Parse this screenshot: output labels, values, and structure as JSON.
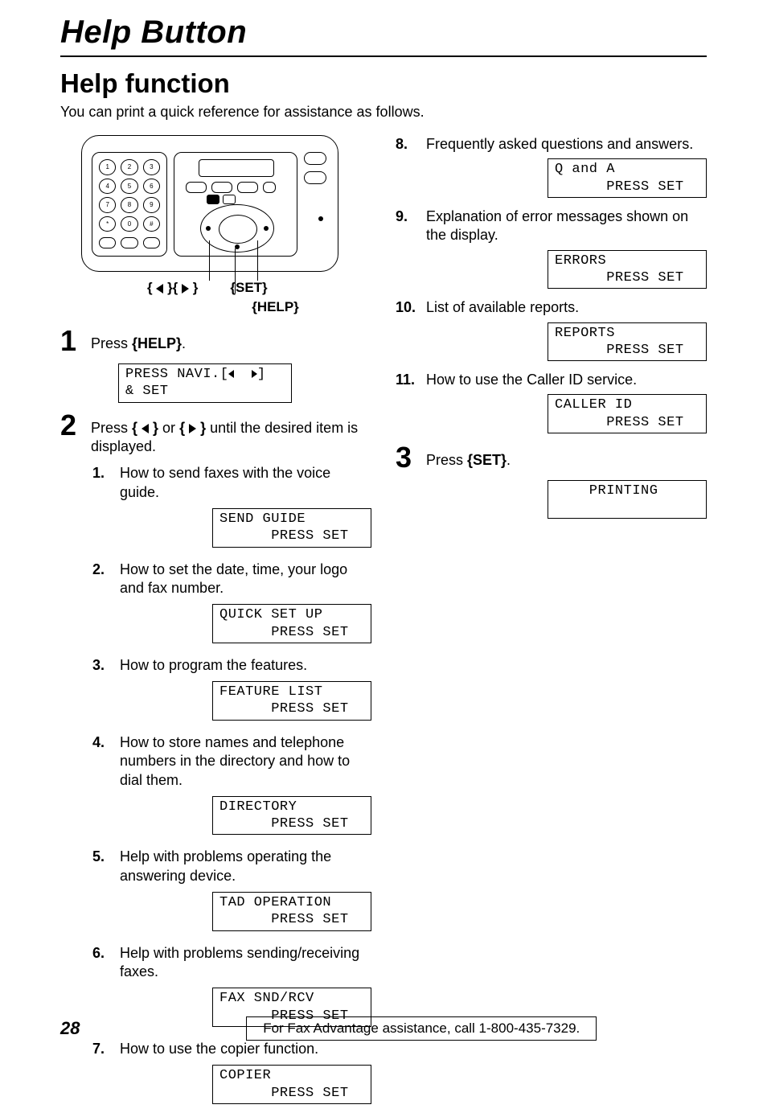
{
  "title": "Help Button",
  "h2": "Help function",
  "intro": "You can print a quick reference for assistance as follows.",
  "labels": {
    "arrows": "{ ◀ }{ ▶ }",
    "set": "{SET}",
    "help": "{HELP}"
  },
  "step1": {
    "num": "1",
    "pre": "Press ",
    "kw": "{HELP}",
    "post": "."
  },
  "lcd_step1_l1": "PRESS NAVI.[",
  "lcd_step1_l1b": "]",
  "lcd_step1_l2": "& SET",
  "step2": {
    "num": "2",
    "t1": "Press ",
    "t2": " or ",
    "t3": " until the desired item is displayed."
  },
  "step3": {
    "num": "3",
    "pre": "Press ",
    "kw": "{SET}",
    "post": "."
  },
  "items": [
    {
      "n": "1.",
      "t": "How to send faxes with the voice guide.",
      "l1": "SEND GUIDE",
      "l2": "      PRESS SET"
    },
    {
      "n": "2.",
      "t": "How to set the date, time, your logo and fax number.",
      "l1": "QUICK SET UP",
      "l2": "      PRESS SET"
    },
    {
      "n": "3.",
      "t": "How to program the features.",
      "l1": "FEATURE LIST",
      "l2": "      PRESS SET"
    },
    {
      "n": "4.",
      "t": "How to store names and telephone numbers in the directory and how to dial them.",
      "l1": "DIRECTORY",
      "l2": "      PRESS SET"
    },
    {
      "n": "5.",
      "t": "Help with problems operating the answering device.",
      "l1": "TAD OPERATION",
      "l2": "      PRESS SET"
    },
    {
      "n": "6.",
      "t": "Help with problems sending/receiving faxes.",
      "l1": "FAX SND/RCV",
      "l2": "      PRESS SET"
    },
    {
      "n": "7.",
      "t": "How to use the copier function.",
      "l1": "COPIER",
      "l2": "      PRESS SET"
    },
    {
      "n": "8.",
      "t": "Frequently asked questions and answers.",
      "l1": "Q and A",
      "l2": "      PRESS SET"
    },
    {
      "n": "9.",
      "t": "Explanation of error messages shown on the display.",
      "l1": "ERRORS",
      "l2": "      PRESS SET"
    },
    {
      "n": "10.",
      "t": "List of available reports.",
      "l1": "REPORTS",
      "l2": "      PRESS SET"
    },
    {
      "n": "11.",
      "t": "How to use the Caller ID service.",
      "l1": "CALLER ID",
      "l2": "      PRESS SET"
    }
  ],
  "lcd_step3_l1": "    PRINTING",
  "lcd_step3_l2": " ",
  "footer": {
    "page": "28",
    "text": "For Fax Advantage assistance, call 1-800-435-7329."
  }
}
